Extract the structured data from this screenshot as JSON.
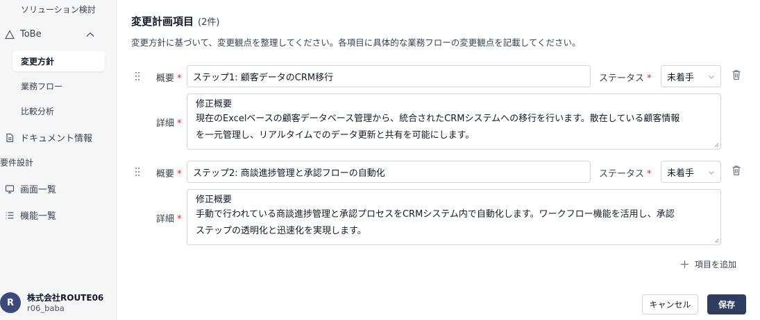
{
  "sidebar": {
    "solution_review": "ソリューション検討",
    "tobe": "ToBe",
    "tobe_items": [
      "変更方針",
      "業務フロー",
      "比較分析"
    ],
    "document_info": "ドキュメント情報",
    "requirements_section": "要件設計",
    "screen_list": "画面一覧",
    "function_list": "機能一覧"
  },
  "user": {
    "avatar_initial": "R",
    "company": "株式会社ROUTE06",
    "id": "r06_baba"
  },
  "main": {
    "title": "変更計画項目",
    "count": "(2件)",
    "description": "変更方針に基づいて、変更観点を整理してください。各項目に具体的な業務フローの変更観点を記載してください。",
    "summary_label": "概要",
    "detail_label": "詳細",
    "status_label": "ステータス",
    "required_mark": "*",
    "items": [
      {
        "summary": "ステップ1: 顧客データのCRM移行",
        "status": "未着手",
        "detail_lines": [
          "修正概要",
          "現在のExcelベースの顧客データベース管理から、統合されたCRMシステムへの移行を行います。散在している顧客情報",
          "を一元管理し、リアルタイムでのデータ更新と共有を可能にします。"
        ]
      },
      {
        "summary": "ステップ2: 商談進捗管理と承認フローの自動化",
        "status": "未着手",
        "detail_lines": [
          "修正概要",
          "手動で行われている商談進捗管理と承認プロセスをCRMシステム内で自動化します。ワークフロー機能を活用し、承認",
          "ステップの透明化と迅速化を実現します。"
        ]
      }
    ],
    "add_item": "項目を追加",
    "cancel": "キャンセル",
    "save": "保存"
  }
}
